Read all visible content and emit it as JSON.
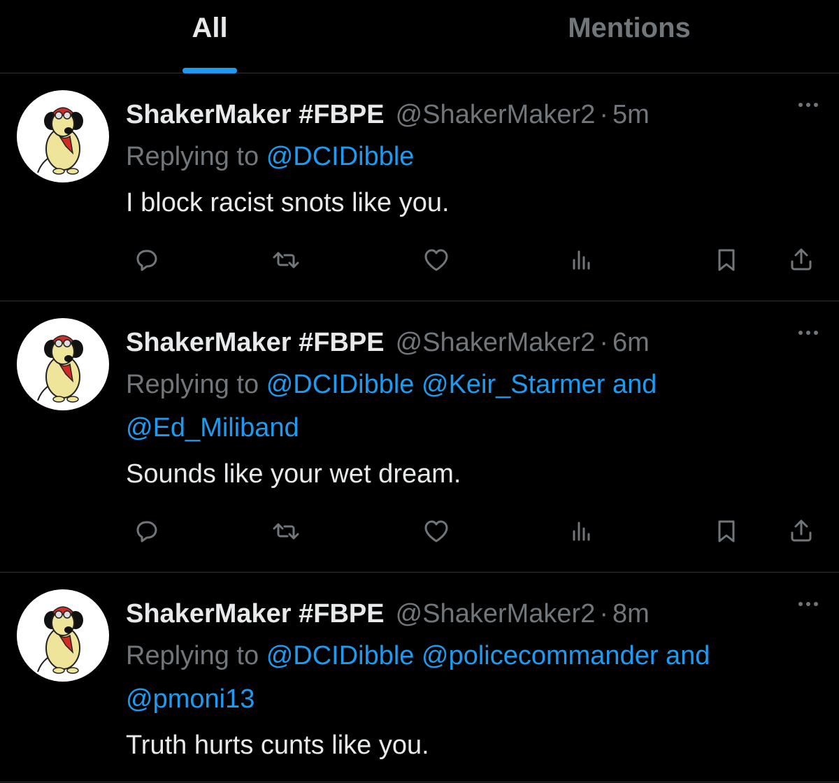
{
  "tabs": [
    {
      "label": "All",
      "active": true
    },
    {
      "label": "Mentions",
      "active": false
    }
  ],
  "colors": {
    "accent": "#1d9bf0",
    "muted": "#71767b",
    "text": "#e7e9ea",
    "background": "#000000"
  },
  "tweets": [
    {
      "name": "ShakerMaker #FBPE",
      "handle": "@ShakerMaker2",
      "separator": "·",
      "time": "5m",
      "replying_prefix": "Replying to",
      "mentions_line1": "@DCIDibble",
      "mentions_line2": "",
      "text": "I block racist snots like you.",
      "avatar_icon": "cartoon-dog-avatar"
    },
    {
      "name": "ShakerMaker #FBPE",
      "handle": "@ShakerMaker2",
      "separator": "·",
      "time": "6m",
      "replying_prefix": "Replying to",
      "mentions_line1": "@DCIDibble @Keir_Starmer and",
      "mentions_line2": "@Ed_Miliband",
      "text": "Sounds like your wet dream.",
      "avatar_icon": "cartoon-dog-avatar"
    },
    {
      "name": "ShakerMaker #FBPE",
      "handle": "@ShakerMaker2",
      "separator": "·",
      "time": "8m",
      "replying_prefix": "Replying to",
      "mentions_line1": "@DCIDibble @policecommander and",
      "mentions_line2": "@pmoni13",
      "text": "Truth hurts cunts like you.",
      "avatar_icon": "cartoon-dog-avatar"
    }
  ],
  "action_icons": [
    "reply-icon",
    "retweet-icon",
    "like-icon",
    "views-icon",
    "bookmark-icon",
    "share-icon"
  ]
}
